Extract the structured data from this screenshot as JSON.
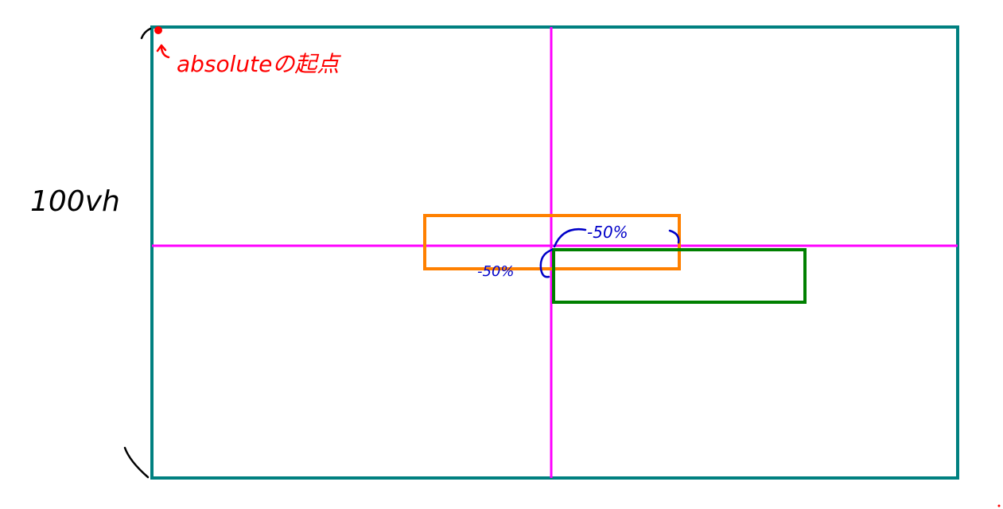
{
  "annotations": {
    "origin_note": "absoluteの起点",
    "height_note": "100vh",
    "offset_x_note": "-50%",
    "offset_y_note": "-50%"
  },
  "colors": {
    "viewport_frame": "#008080",
    "center_axes": "#ff00ff",
    "translated_box": "#ff8000",
    "absolute_box": "#008000",
    "red_ink": "#ff0000",
    "blue_ink": "#0000c8",
    "black_ink": "#000000"
  }
}
